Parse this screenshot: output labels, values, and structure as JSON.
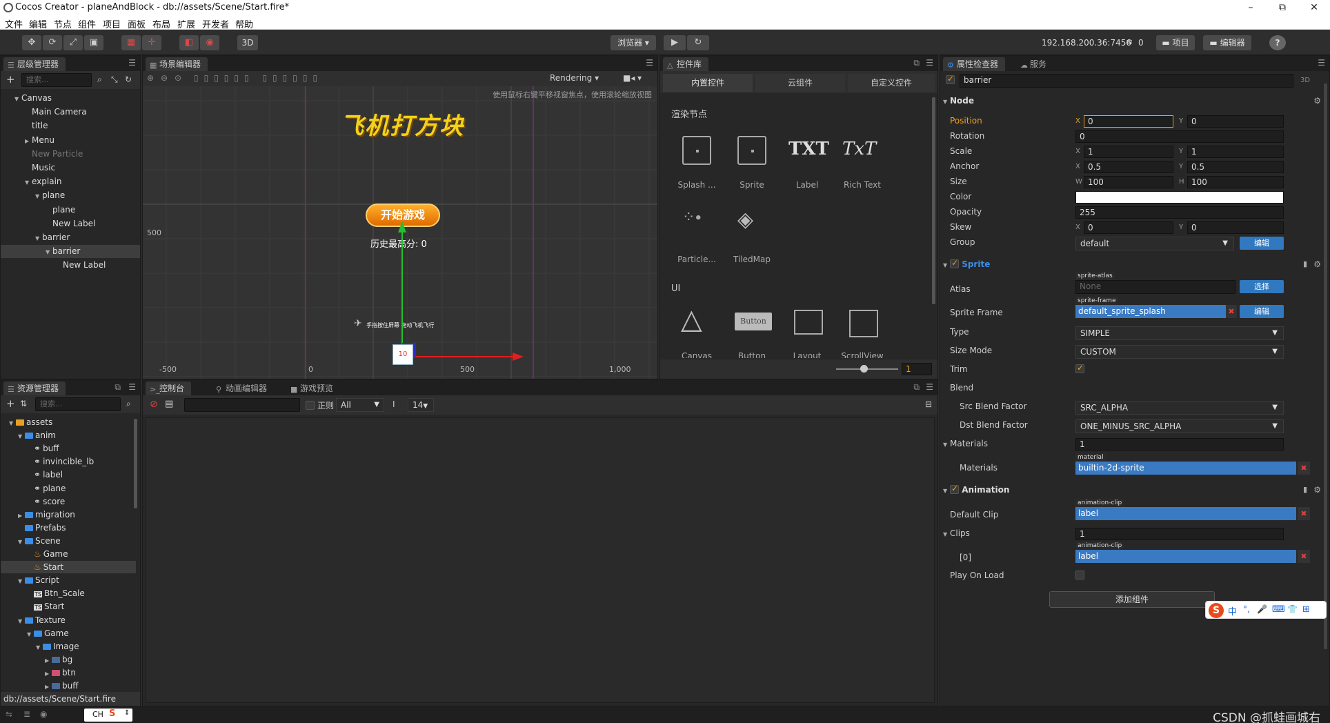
{
  "window": {
    "title": "Cocos Creator - planeAndBlock - db://assets/Scene/Start.fire*",
    "min": "–",
    "max": "⧉",
    "close": "✕"
  },
  "menu": [
    "文件",
    "编辑",
    "节点",
    "组件",
    "项目",
    "面板",
    "布局",
    "扩展",
    "开发者",
    "帮助"
  ],
  "toolbar": {
    "mode3d": "3D",
    "browser": "浏览器 ▾",
    "ip": "192.168.200.36:7456",
    "count": "0",
    "project": "项目",
    "editor": "编辑器",
    "help": "?"
  },
  "hierarchy": {
    "tab": "层级管理器",
    "search_placeholder": "搜索...",
    "nodes": [
      {
        "label": "Canvas",
        "indent": 0,
        "arrow": "▼"
      },
      {
        "label": "Main Camera",
        "indent": 1,
        "arrow": ""
      },
      {
        "label": "title",
        "indent": 1,
        "arrow": ""
      },
      {
        "label": "Menu",
        "indent": 1,
        "arrow": "▶"
      },
      {
        "label": "New Particle",
        "indent": 1,
        "arrow": "",
        "dim": true
      },
      {
        "label": "Music",
        "indent": 1,
        "arrow": ""
      },
      {
        "label": "explain",
        "indent": 1,
        "arrow": "▼"
      },
      {
        "label": "plane",
        "indent": 2,
        "arrow": "▼"
      },
      {
        "label": "plane",
        "indent": 3,
        "arrow": ""
      },
      {
        "label": "New Label",
        "indent": 3,
        "arrow": ""
      },
      {
        "label": "barrier",
        "indent": 2,
        "arrow": "▼"
      },
      {
        "label": "barrier",
        "indent": 3,
        "arrow": "▼",
        "selected": true
      },
      {
        "label": "New Label",
        "indent": 4,
        "arrow": ""
      }
    ]
  },
  "scene": {
    "tab": "场景编辑器",
    "rendering": "Rendering",
    "hint": "使用鼠标右键平移视窗焦点，使用滚轮缩放视图",
    "title_art": "飞机打方块",
    "start_btn": "开始游戏",
    "high_score": "历史最高分: 0",
    "plane_caption": "手指按住屏幕 拖动飞机飞行",
    "box_num": "10",
    "axis_y_500": "500",
    "axis_x": [
      "-500",
      "0",
      "500",
      "1,000"
    ]
  },
  "library": {
    "tab": "控件库",
    "tabs": [
      "内置控件",
      "云组件",
      "自定义控件"
    ],
    "render_title": "渲染节点",
    "items": [
      "Splash ...",
      "Sprite",
      "Label",
      "Rich Text",
      "Particle...",
      "TiledMap"
    ],
    "txt1": "TXT",
    "txt2": "TxT",
    "ui_title": "UI",
    "ui_items": [
      "Canvas",
      "Button",
      "Layout",
      "ScrollView"
    ],
    "button_text": "Button",
    "zoom": "1"
  },
  "assets": {
    "tab": "资源管理器",
    "search_placeholder": "搜索...",
    "items": [
      {
        "label": "assets",
        "indent": 0,
        "arrow": "▼",
        "type": "root"
      },
      {
        "label": "anim",
        "indent": 1,
        "arrow": "▼",
        "type": "folder"
      },
      {
        "label": "buff",
        "indent": 2,
        "arrow": "",
        "type": "anim"
      },
      {
        "label": "invincible_lb",
        "indent": 2,
        "arrow": "",
        "type": "anim"
      },
      {
        "label": "label",
        "indent": 2,
        "arrow": "",
        "type": "anim"
      },
      {
        "label": "plane",
        "indent": 2,
        "arrow": "",
        "type": "anim"
      },
      {
        "label": "score",
        "indent": 2,
        "arrow": "",
        "type": "anim"
      },
      {
        "label": "migration",
        "indent": 1,
        "arrow": "▶",
        "type": "folder"
      },
      {
        "label": "Prefabs",
        "indent": 1,
        "arrow": "",
        "type": "folder"
      },
      {
        "label": "Scene",
        "indent": 1,
        "arrow": "▼",
        "type": "folder"
      },
      {
        "label": "Game",
        "indent": 2,
        "arrow": "",
        "type": "fire"
      },
      {
        "label": "Start",
        "indent": 2,
        "arrow": "",
        "type": "fire",
        "selected": true
      },
      {
        "label": "Script",
        "indent": 1,
        "arrow": "▼",
        "type": "folder"
      },
      {
        "label": "Btn_Scale",
        "indent": 2,
        "arrow": "",
        "type": "ts"
      },
      {
        "label": "Start",
        "indent": 2,
        "arrow": "",
        "type": "ts"
      },
      {
        "label": "Texture",
        "indent": 1,
        "arrow": "▼",
        "type": "folder"
      },
      {
        "label": "Game",
        "indent": 2,
        "arrow": "▼",
        "type": "folder"
      },
      {
        "label": "Image",
        "indent": 3,
        "arrow": "▼",
        "type": "folder"
      },
      {
        "label": "bg",
        "indent": 4,
        "arrow": "▶",
        "type": "img"
      },
      {
        "label": "btn",
        "indent": 4,
        "arrow": "▶",
        "type": "img2"
      },
      {
        "label": "buff",
        "indent": 4,
        "arrow": "▶",
        "type": "img"
      }
    ],
    "path": "db://assets/Scene/Start.fire"
  },
  "console": {
    "tabs": [
      "控制台",
      "动画编辑器",
      "游戏预览"
    ],
    "regex": "正则",
    "filter": "All",
    "fontsize": "14"
  },
  "inspector": {
    "tabs": [
      "属性检查器",
      "服务"
    ],
    "node_name": "barrier",
    "d3": "3D",
    "node_section": "Node",
    "position": {
      "label": "Position",
      "x": "0",
      "y": "0"
    },
    "rotation": {
      "label": "Rotation",
      "v": "0"
    },
    "scale": {
      "label": "Scale",
      "x": "1",
      "y": "1"
    },
    "anchor": {
      "label": "Anchor",
      "x": "0.5",
      "y": "0.5"
    },
    "size": {
      "label": "Size",
      "w": "100",
      "h": "100"
    },
    "color": {
      "label": "Color",
      "value": "#ffffff"
    },
    "opacity": {
      "label": "Opacity",
      "v": "255"
    },
    "skew": {
      "label": "Skew",
      "x": "0",
      "y": "0"
    },
    "group": {
      "label": "Group",
      "v": "default",
      "btn": "编辑"
    },
    "sprite": {
      "title": "Sprite",
      "atlas": "Atlas",
      "atlas_tag": "sprite-atlas",
      "atlas_val": "None",
      "atlas_btn": "选择",
      "frame": "Sprite Frame",
      "frame_tag": "sprite-frame",
      "frame_val": "default_sprite_splash",
      "frame_btn": "编辑",
      "type": "Type",
      "type_v": "SIMPLE",
      "sizemode": "Size Mode",
      "sizemode_v": "CUSTOM",
      "trim": "Trim",
      "blend": "Blend",
      "src": "Src Blend Factor",
      "src_v": "SRC_ALPHA",
      "dst": "Dst Blend Factor",
      "dst_v": "ONE_MINUS_SRC_ALPHA",
      "materials": "Materials",
      "materials_count": "1",
      "materials_item": "Materials",
      "material_tag": "material",
      "material_val": "builtin-2d-sprite"
    },
    "animation": {
      "title": "Animation",
      "default_clip": "Default Clip",
      "clip_tag": "animation-clip",
      "clip_val": "label",
      "clips": "Clips",
      "clips_count": "1",
      "clip0": "[0]",
      "clip0_val": "label",
      "play_on_load": "Play On Load"
    },
    "add_component": "添加组件"
  },
  "statusbar": {
    "ime": "CH",
    "watermark": "CSDN @抓蛙画城右"
  },
  "ime_bar": {
    "items": [
      "中",
      "°,",
      "🎤",
      "⌨",
      "👕",
      "⊞"
    ]
  },
  "coord_labels": {
    "x": "X",
    "y": "Y",
    "w": "W",
    "h": "H"
  }
}
